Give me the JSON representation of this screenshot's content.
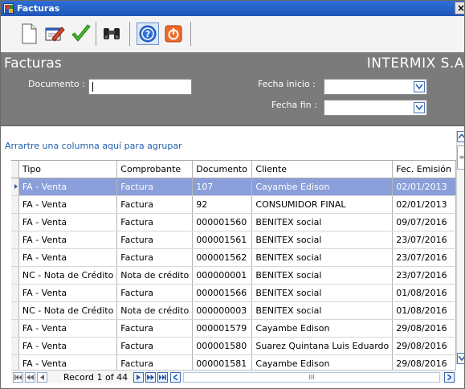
{
  "window": {
    "title": "Facturas",
    "close_glyph": "×"
  },
  "toolbar": {
    "buttons": [
      {
        "name": "new-icon"
      },
      {
        "name": "edit-icon"
      },
      {
        "name": "check-icon"
      },
      {
        "name": "search-binoculars-icon"
      },
      {
        "name": "help-icon"
      },
      {
        "name": "power-icon"
      }
    ]
  },
  "header": {
    "form_title": "Facturas",
    "company": "INTERMIX S.A",
    "documento_label": "Documento :",
    "documento_value": "",
    "fecha_inicio_label": "Fecha inicio :",
    "fecha_inicio_value": "",
    "fecha_fin_label": "Fecha fin :",
    "fecha_fin_value": ""
  },
  "grid": {
    "group_panel_text": "Arrartre una columna aquí para agrupar",
    "columns": [
      "Tipo",
      "Comprobante",
      "Documento",
      "Cliente",
      "Fec. Emisión"
    ],
    "rows": [
      [
        "FA - Venta",
        "Factura",
        "107",
        "Cayambe Edison",
        "02/01/2013"
      ],
      [
        "FA - Venta",
        "Factura",
        "92",
        "CONSUMIDOR FINAL",
        "02/01/2013"
      ],
      [
        "FA - Venta",
        "Factura",
        "000001560",
        "BENITEX social",
        "09/07/2016"
      ],
      [
        "FA - Venta",
        "Factura",
        "000001561",
        "BENITEX social",
        "23/07/2016"
      ],
      [
        "FA - Venta",
        "Factura",
        "000001562",
        "BENITEX social",
        "23/07/2016"
      ],
      [
        "NC - Nota de Crédito",
        "Nota de crédito",
        "000000001",
        "BENITEX social",
        "23/07/2016"
      ],
      [
        "FA - Venta",
        "Factura",
        "000001566",
        "BENITEX social",
        "01/08/2016"
      ],
      [
        "NC - Nota de Crédito",
        "Nota de crédito",
        "000000003",
        "BENITEX social",
        "01/08/2016"
      ],
      [
        "FA - Venta",
        "Factura",
        "000001579",
        "Cayambe Edison",
        "29/08/2016"
      ],
      [
        "FA - Venta",
        "Factura",
        "000001580",
        "Suarez Quintana Luis Eduardo",
        "29/08/2016"
      ],
      [
        "FA - Venta",
        "Factura",
        "000001581",
        "Cayambe Edison",
        "29/08/2016"
      ]
    ],
    "selected_row": 0
  },
  "navigator": {
    "record_text": "Record 1 of 44",
    "scroll_grip": "III"
  },
  "colors": {
    "header_bg": "#7b7b7b",
    "selected_row": "#8a9fda",
    "title_bar": "#2e6fd6",
    "link": "#1f5fae"
  }
}
